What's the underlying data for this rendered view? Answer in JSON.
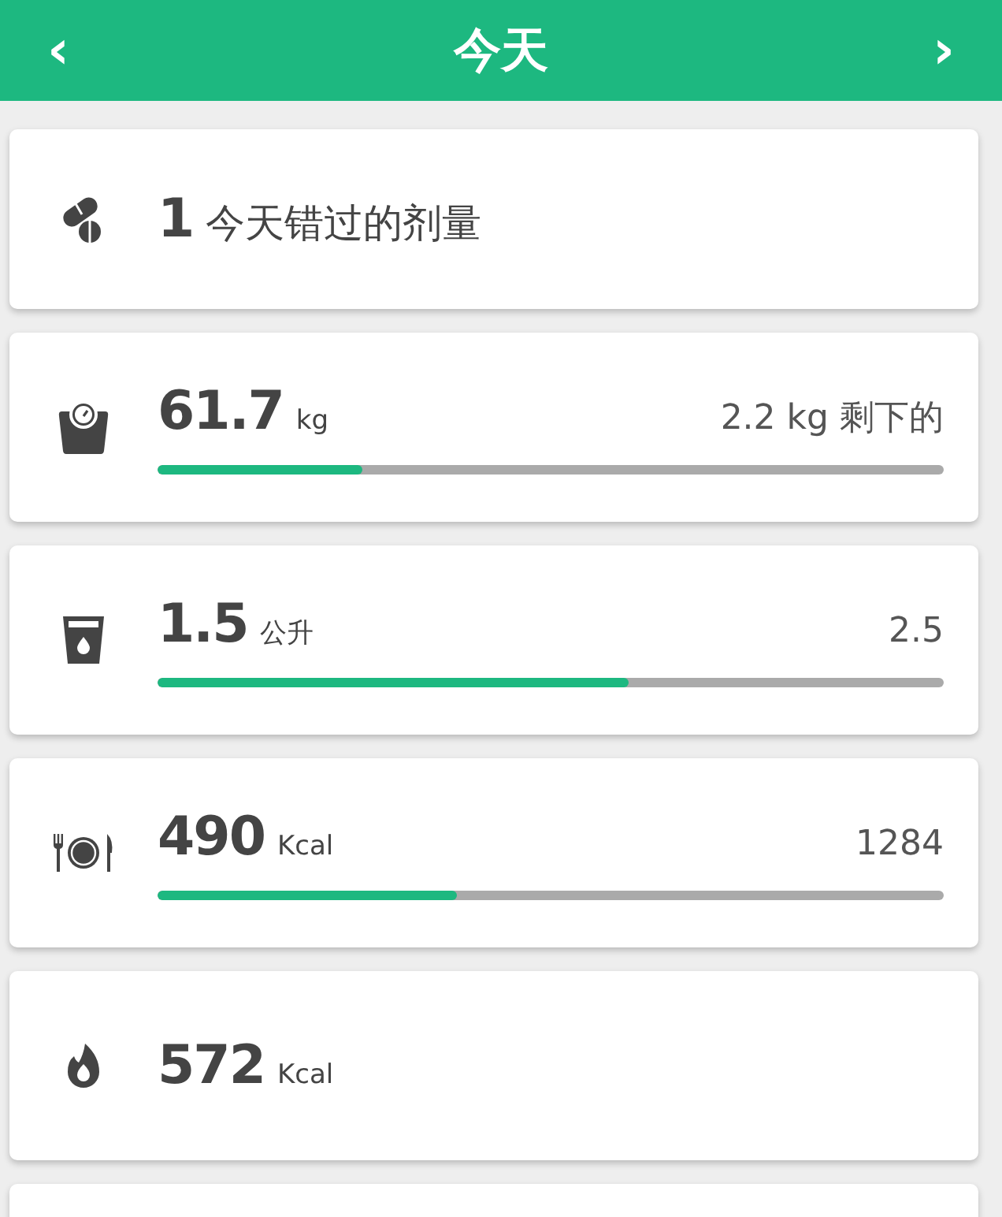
{
  "header": {
    "prev": "‹",
    "title": "今天",
    "next": "›"
  },
  "cards": [
    {
      "kind": "pills",
      "value": "1",
      "label": "今天错过的剂量"
    },
    {
      "kind": "scale",
      "value": "61.7",
      "unit": "kg",
      "goal": "2.2 kg 剩下的",
      "level": 0.26
    },
    {
      "kind": "water",
      "value": "1.5",
      "unit": "公升",
      "goal": "2.5",
      "level": 0.6
    },
    {
      "kind": "meal",
      "value": "490",
      "unit": "Kcal",
      "goal": "1284",
      "level": 0.38
    },
    {
      "kind": "flame",
      "value": "572",
      "unit": "Kcal"
    }
  ]
}
